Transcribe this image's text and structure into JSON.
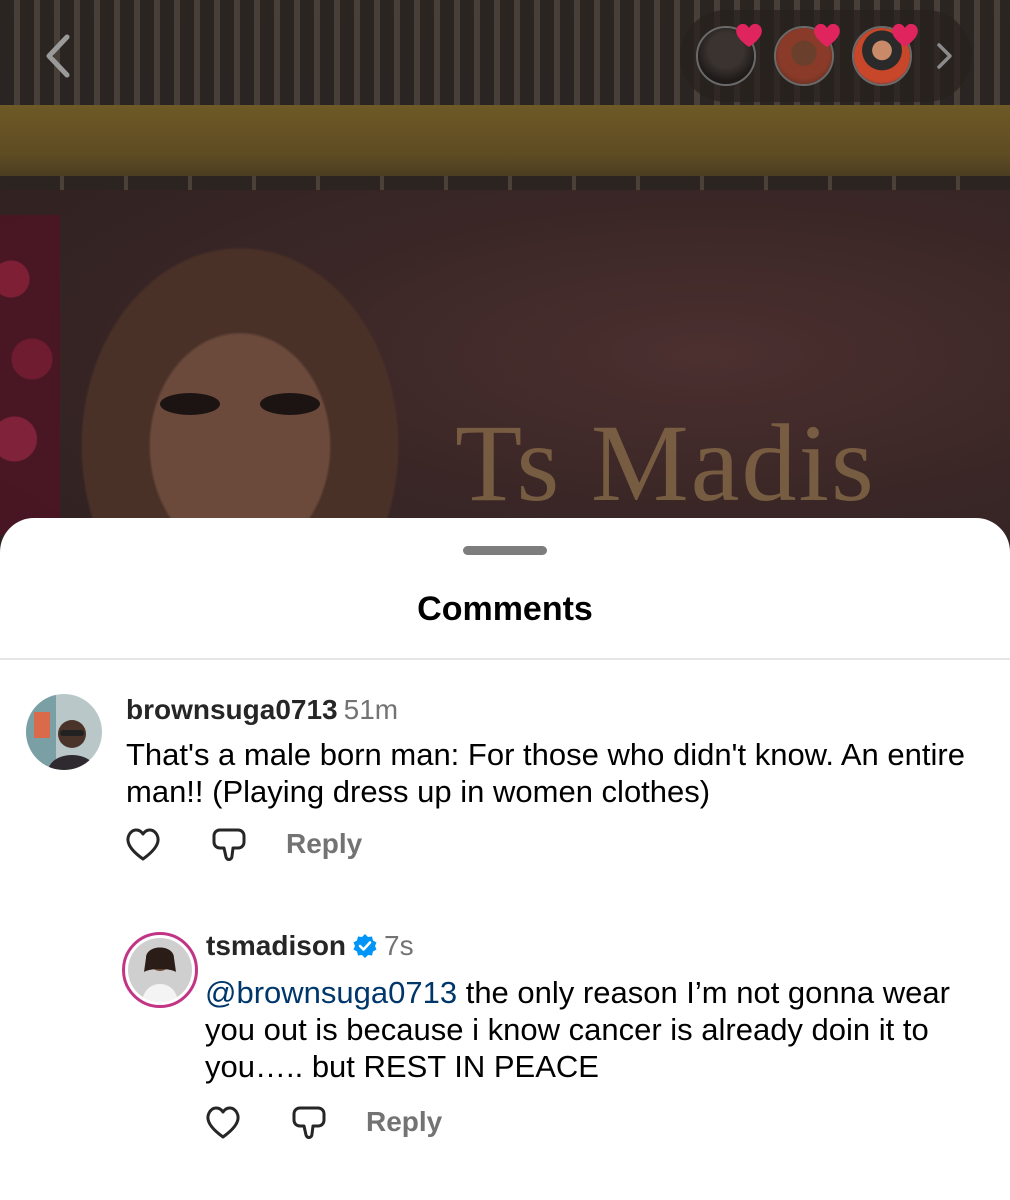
{
  "background": {
    "sign_text": "Ts Madis"
  },
  "sheet": {
    "title": "Comments"
  },
  "comments": [
    {
      "username": "brownsuga0713",
      "time": "51m",
      "text": "That's a male born man: For those who didn't know. An entire man!! (Playing dress up in women clothes)",
      "reply_label": "Reply"
    },
    {
      "username": "tsmadison",
      "time": "7s",
      "verified": true,
      "mention": "@brownsuga0713",
      "text": " the only reason I’m not gonna wear you out is because i know cancer is already doin it to you….. but REST IN PEACE",
      "reply_label": "Reply"
    }
  ],
  "colors": {
    "mention": "#00376b",
    "verified_badge": "#0095f6",
    "story_heart": "#e0245e",
    "meta_gray": "#737373"
  },
  "icons": {
    "back": "chevron-left-icon",
    "next": "chevron-right-icon",
    "like": "heart-outline-icon",
    "dislike": "thumbs-down-outline-icon",
    "verified": "verified-badge-icon"
  }
}
